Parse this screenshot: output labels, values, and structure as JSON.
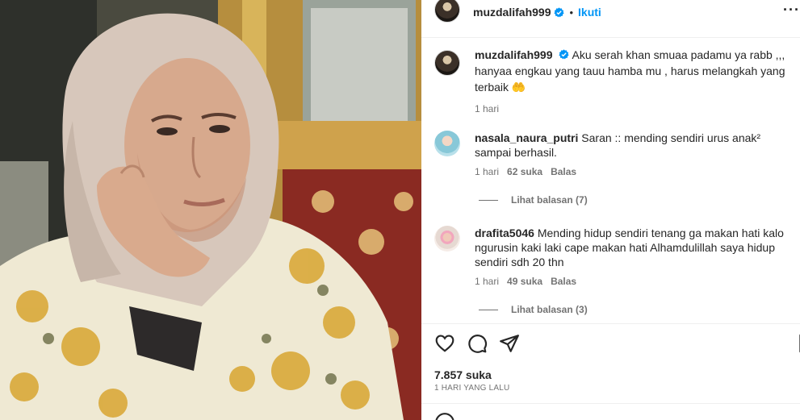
{
  "post": {
    "username": "muzdalifah999",
    "dot": "•",
    "follow_label": "Ikuti",
    "more_label": "···",
    "caption_text": "Aku serah khan smuaa padamu ya rabb ,,, hanyaa engkau yang tauu hamba mu , harus melangkah yang terbaik 🤲",
    "caption_time": "1 hari"
  },
  "comments": [
    {
      "username": "nasala_naura_putri",
      "text": "Saran :: mending sendiri urus anak² sampai berhasil.",
      "time": "1 hari",
      "likes": "62 suka",
      "reply": "Balas",
      "view_replies": "Lihat balasan (7)"
    },
    {
      "username": "drafita5046",
      "text": "Mending hidup sendiri tenang ga makan hati kalo ngurusin kaki laki cape makan hati Alhamdulillah saya hidup sendiri sdh 20 thn",
      "time": "1 hari",
      "likes": "49 suka",
      "reply": "Balas",
      "view_replies": "Lihat balasan (3)"
    }
  ],
  "footer": {
    "likes": "7.857 suka",
    "date": "1 HARI YANG LALU"
  },
  "colors": {
    "accent": "#0095f6",
    "muted": "#737373",
    "text": "#262626"
  },
  "icons": [
    "verified-badge-icon",
    "heart-icon",
    "comment-icon",
    "share-icon",
    "bookmark-icon",
    "emoji-icon"
  ]
}
